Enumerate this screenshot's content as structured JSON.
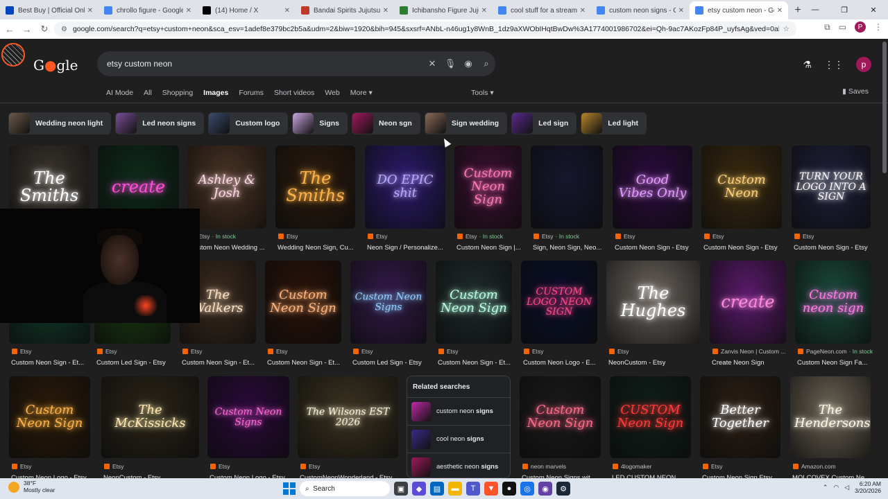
{
  "browser": {
    "tabs": [
      {
        "title": "Best Buy | Official Online S",
        "color": "#0046be"
      },
      {
        "title": "chrollo figure - Google Sea",
        "color": "#4285f4"
      },
      {
        "title": "(14) Home / X",
        "color": "#000000"
      },
      {
        "title": "Bandai Spirits Jujutsu Kais",
        "color": "#c0392b"
      },
      {
        "title": "Ichibansho Figure Jujutsu",
        "color": "#2e7d32"
      },
      {
        "title": "cool stuff for a streaming",
        "color": "#4285f4"
      },
      {
        "title": "custom neon signs - Goog",
        "color": "#4285f4"
      },
      {
        "title": "etsy custom neon - Googl",
        "color": "#4285f4"
      }
    ],
    "active_tab": 7,
    "new_tab": "+",
    "url": "google.com/search?q=etsy+custom+neon&sca_esv=1adef8e379bc2b5a&udm=2&biw=1920&bih=945&sxsrf=ANbL-n46ug1y8WnB_1dz9aXWObIHqtBwDw%3A1774001986702&ei=Qh-9ac7AKozFp84P_uyfsAg&ved=0ahUKEwjO6f2xoK6TAxWM4...",
    "profile_initial": "P"
  },
  "google": {
    "logo_text_a": "G",
    "logo_text_b": "gle",
    "query": "etsy custom neon",
    "nav_tabs": [
      "AI Mode",
      "All",
      "Shopping",
      "Images",
      "Forums",
      "Short videos",
      "Web",
      "More ▾"
    ],
    "selected_tab": "Images",
    "tools": "Tools ▾",
    "saves": "Saves",
    "avatar_initial": "p",
    "chips": [
      {
        "label": "Wedding neon light",
        "color": "#6b5a48"
      },
      {
        "label": "Led neon signs",
        "color": "#7a4f9a"
      },
      {
        "label": "Custom logo",
        "color": "#3a4b6b"
      },
      {
        "label": "Signs",
        "color": "#c9a6e0"
      },
      {
        "label": "Neon sgn",
        "color": "#a0195b"
      },
      {
        "label": "Sign wedding",
        "color": "#8a6a58"
      },
      {
        "label": "Led sign",
        "color": "#5a2a8a"
      },
      {
        "label": "Led light",
        "color": "#b8862a"
      }
    ]
  },
  "results": {
    "row1": [
      {
        "neon": "The Smiths",
        "src": "",
        "stock": "",
        "cap": ""
      },
      {
        "neon": "create",
        "src": "",
        "stock": "",
        "cap": ""
      },
      {
        "neon": "Ashley & Josh",
        "src": "Etsy",
        "stock": "· In stock",
        "cap": "Custom Neon Wedding ..."
      },
      {
        "neon": "The Smiths",
        "src": "Etsy",
        "stock": "",
        "cap": "Wedding Neon Sign, Cu..."
      },
      {
        "neon": "DO EPIC shit",
        "src": "Etsy",
        "stock": "",
        "cap": "Neon Sign / Personalize..."
      },
      {
        "neon": "Custom Neon Sign",
        "src": "Etsy",
        "stock": "· In stock",
        "cap": "Custom Neon Sign |..."
      },
      {
        "neon": "",
        "src": "Etsy",
        "stock": "· In stock",
        "cap": "Sign, Neon Sign, Neo..."
      },
      {
        "neon": "Good Vibes Only",
        "src": "Etsy",
        "stock": "",
        "cap": "Custom Neon Sign - Etsy"
      },
      {
        "neon": "Custom Neon",
        "src": "Etsy",
        "stock": "",
        "cap": "Custom Neon Sign - Etsy"
      },
      {
        "neon": "TURN YOUR LOGO INTO A SIGN",
        "src": "Etsy",
        "stock": "",
        "cap": "Custom Neon Sign - Etsy"
      }
    ],
    "row2": [
      {
        "neon": "",
        "src": "Etsy",
        "stock": "",
        "cap": "Custom Neon Sign - Et..."
      },
      {
        "neon": "",
        "src": "Etsy",
        "stock": "",
        "cap": "Custom Led Sign - Etsy"
      },
      {
        "neon": "The Walkers",
        "src": "Etsy",
        "stock": "",
        "cap": "Custom Neon Sign - Et..."
      },
      {
        "neon": "Custom Neon Sign",
        "src": "Etsy",
        "stock": "",
        "cap": "Custom Neon Sign - Et..."
      },
      {
        "neon": "Custom Neon Signs",
        "src": "Etsy",
        "stock": "",
        "cap": "Custom Led Sign - Etsy"
      },
      {
        "neon": "Custom Neon Sign",
        "src": "Etsy",
        "stock": "",
        "cap": "Custom Neon Sign - Et..."
      },
      {
        "neon": "CUSTOM LOGO NEON SIGN",
        "src": "Etsy",
        "stock": "",
        "cap": "Custom Neon Logo - E..."
      },
      {
        "neon": "The Hughes",
        "src": "Etsy",
        "stock": "",
        "cap": "NeonCustom - Etsy"
      },
      {
        "neon": "create",
        "src": "Zanvis Neon | Custom ...",
        "stock": "",
        "cap": "Create Neon Sign"
      },
      {
        "neon": "Custom neon sign",
        "src": "PageNeon.com",
        "stock": "· In stock",
        "cap": "Custom Neon Sign Fa..."
      }
    ],
    "row3": [
      {
        "neon": "Custom Neon Sign",
        "src": "Etsy",
        "stock": "",
        "cap": "Custom Neon Logo - Etsy"
      },
      {
        "neon": "The McKissicks",
        "src": "Etsy",
        "stock": "",
        "cap": "NeonCustom - Etsy"
      },
      {
        "neon": "Custom Neon Signs",
        "src": "Etsy",
        "stock": "",
        "cap": "Custom Neon Logo - Etsy"
      },
      {
        "neon": "The Wilsons EST 2026",
        "src": "Etsy",
        "stock": "",
        "cap": "CustomNeonWonderland - Etsy"
      },
      {
        "neon": "Custom Neon Sign",
        "src": "neon marvels",
        "stock": "",
        "cap": "Custom Neon Signs wit..."
      },
      {
        "neon": "CUSTOM Neon Sign",
        "src": "4logomaker",
        "stock": "",
        "cap": "LED CUSTOM NEON ..."
      },
      {
        "neon": "Better Together",
        "src": "Etsy",
        "stock": "",
        "cap": "Custom Neon Sign Etsy ..."
      },
      {
        "neon": "The Hendersons",
        "src": "Amazon.com",
        "stock": "",
        "cap": "MOLCOVEX Custom Ne..."
      }
    ]
  },
  "related": {
    "title": "Related searches",
    "items": [
      {
        "plain": "custom neon ",
        "bold": "signs"
      },
      {
        "plain": "cool neon ",
        "bold": "signs"
      },
      {
        "plain": "aesthetic neon ",
        "bold": "signs"
      }
    ]
  },
  "taskbar": {
    "temp": "38°F",
    "weather": "Mostly clear",
    "search": "Search",
    "time": "6:20 AM",
    "date": "3/20/2026"
  }
}
